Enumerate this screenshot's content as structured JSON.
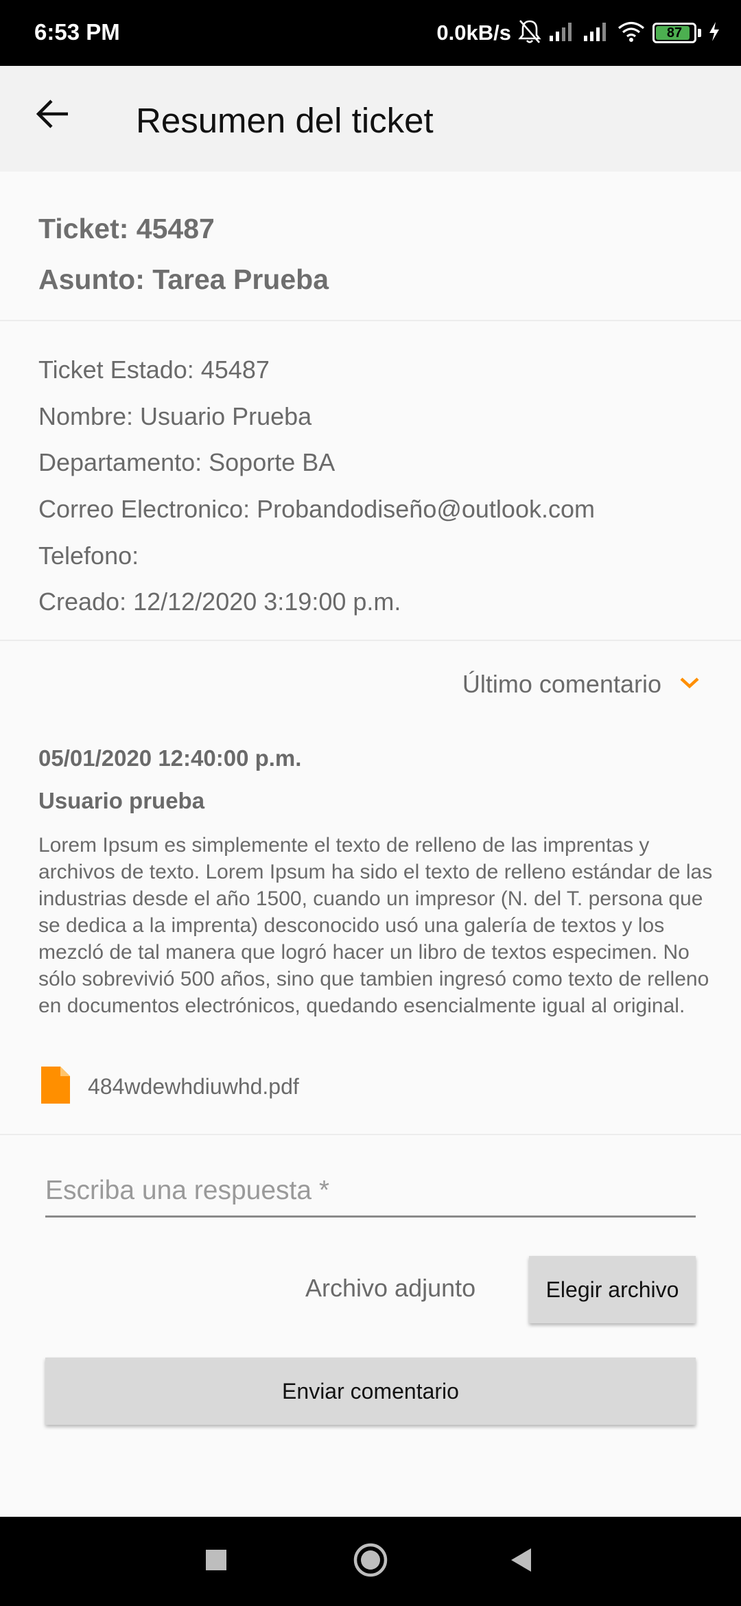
{
  "status_bar": {
    "time": "6:53 PM",
    "network_speed": "0.0kB/s",
    "battery_level": "87",
    "icons": [
      "mute-notifications-icon",
      "signal-icon",
      "signal-icon",
      "wifi-icon",
      "battery-icon",
      "charging-icon"
    ]
  },
  "app_bar": {
    "title": "Resumen del ticket",
    "back_icon": "arrow-back-icon"
  },
  "ticket": {
    "number_line": "Ticket: 45487",
    "subject_line": "Asunto: Tarea Prueba"
  },
  "details": [
    "Ticket Estado: 45487",
    "Nombre: Usuario Prueba",
    "Departamento: Soporte BA",
    "Correo Electronico: Probandodiseño@outlook.com",
    "Telefono:",
    "Creado: 12/12/2020 3:19:00 p.m."
  ],
  "last_comment": {
    "toggle_label": "Último comentario",
    "date": "05/01/2020 12:40:00 p.m.",
    "user": "Usuario prueba",
    "body": "Lorem Ipsum es simplemente el texto de relleno de las imprentas y archivos de texto. Lorem Ipsum ha sido el texto de relleno estándar de las industrias desde el año 1500, cuando un impresor (N. del T. persona que se dedica a la imprenta) desconocido usó una galería de textos y los mezcló de tal manera que logró hacer un libro de textos especimen. No sólo sobrevivió 500 años, sino que tambien ingresó como texto de relleno en documentos electrónicos, quedando esencialmente igual al original.",
    "attachment_name": "484wdewhdiuwhd.pdf"
  },
  "reply": {
    "placeholder": "Escriba una respuesta *",
    "value": "",
    "attachment_label": "Archivo adjunto",
    "choose_file_label": "Elegir archivo",
    "send_label": "Enviar comentario"
  },
  "colors": {
    "accent": "#ff8f00",
    "text_muted": "#6a6a6a",
    "button_bg": "#d9d9d9",
    "app_bar_bg": "#f2f2f2"
  }
}
